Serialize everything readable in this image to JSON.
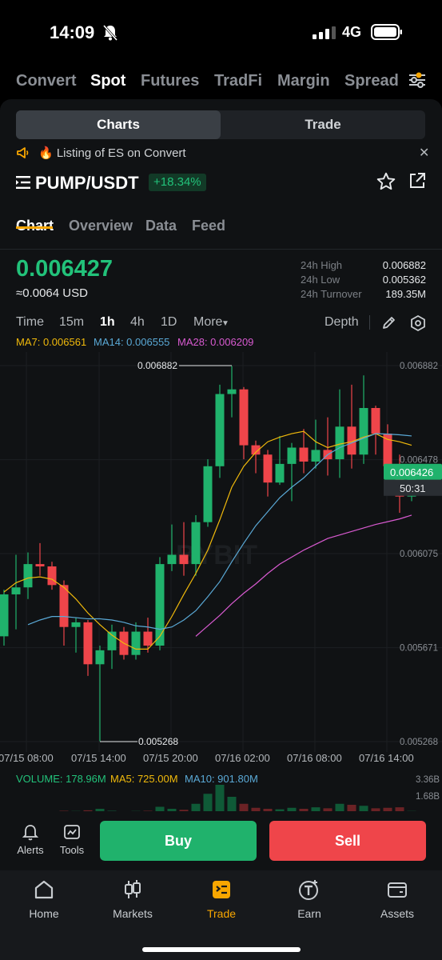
{
  "status_bar": {
    "time": "14:09",
    "network": "4G"
  },
  "top_nav": {
    "items": [
      "Convert",
      "Spot",
      "Futures",
      "TradFi",
      "Margin",
      "Spread"
    ],
    "active": "Spot"
  },
  "toggle": {
    "left": "Charts",
    "right": "Trade"
  },
  "announcement": {
    "text": "🔥 Listing of ES on Convert"
  },
  "pair": {
    "name": "PUMP/USDT",
    "change": "+18.34%"
  },
  "sub_tabs": [
    "Chart",
    "Overview",
    "Data",
    "Feed"
  ],
  "price": {
    "last": "0.006427",
    "usd": "≈0.0064 USD"
  },
  "stats": {
    "high_label": "24h High",
    "high": "0.006882",
    "low_label": "24h Low",
    "low": "0.005362",
    "turnover_label": "24h Turnover",
    "turnover": "189.35M"
  },
  "intervals": {
    "items": [
      "Time",
      "15m",
      "1h",
      "4h",
      "1D",
      "More"
    ],
    "active": "1h",
    "depth": "Depth"
  },
  "ma": {
    "ma7": "MA7: 0.006561",
    "ma14": "MA14: 0.006555",
    "ma28": "MA28: 0.006209"
  },
  "colors": {
    "up": "#20b26c",
    "down": "#ef454a",
    "ma7": "#f0b90b",
    "ma14": "#5aa9d6",
    "ma28": "#d85ad0",
    "accent": "#f7a600"
  },
  "chart_data": {
    "type": "candlestick",
    "y_ticks": [
      "0.006882",
      "0.006478",
      "0.006075",
      "0.005671",
      "0.005268"
    ],
    "x_ticks": [
      "07/15 08:00",
      "07/15 14:00",
      "07/15 20:00",
      "07/16 02:00",
      "07/16 08:00",
      "07/16 14:00"
    ],
    "ylim": [
      0.005268,
      0.006882
    ],
    "high_marker": "0.006882",
    "low_marker": "0.005268",
    "current_price": "0.006426",
    "countdown": "50:31",
    "candles": [
      [
        0.00572,
        0.0059,
        0.00568,
        0.00592
      ],
      [
        0.0059,
        0.00593,
        0.00575,
        0.00607
      ],
      [
        0.00593,
        0.00603,
        0.00588,
        0.00608
      ],
      [
        0.00603,
        0.00602,
        0.00598,
        0.00612
      ],
      [
        0.00602,
        0.00594,
        0.00592,
        0.00604
      ],
      [
        0.00594,
        0.00576,
        0.00568,
        0.00596
      ],
      [
        0.00576,
        0.00578,
        0.00565,
        0.0058
      ],
      [
        0.00578,
        0.0056,
        0.00555,
        0.00579
      ],
      [
        0.0056,
        0.00566,
        0.00527,
        0.00568
      ],
      [
        0.00566,
        0.00574,
        0.00558,
        0.00577
      ],
      [
        0.00574,
        0.00564,
        0.00562,
        0.00576
      ],
      [
        0.00564,
        0.00574,
        0.00562,
        0.00578
      ],
      [
        0.00574,
        0.00568,
        0.00565,
        0.0058
      ],
      [
        0.00568,
        0.00603,
        0.00566,
        0.00606
      ],
      [
        0.00603,
        0.00607,
        0.006,
        0.0062
      ],
      [
        0.00607,
        0.00603,
        0.00598,
        0.00621
      ],
      [
        0.00603,
        0.00621,
        0.00598,
        0.00624
      ],
      [
        0.00621,
        0.00645,
        0.00619,
        0.00648
      ],
      [
        0.00645,
        0.00676,
        0.0064,
        0.0068
      ],
      [
        0.00676,
        0.00678,
        0.00666,
        0.00688
      ],
      [
        0.00678,
        0.00654,
        0.00648,
        0.00679
      ],
      [
        0.00654,
        0.0065,
        0.00642,
        0.00656
      ],
      [
        0.0065,
        0.00638,
        0.00632,
        0.00652
      ],
      [
        0.00638,
        0.00646,
        0.00637,
        0.00658
      ],
      [
        0.00646,
        0.00653,
        0.0063,
        0.00655
      ],
      [
        0.00653,
        0.00647,
        0.00642,
        0.00661
      ],
      [
        0.00647,
        0.00652,
        0.00644,
        0.00665
      ],
      [
        0.00652,
        0.00648,
        0.00641,
        0.00666
      ],
      [
        0.00648,
        0.00662,
        0.0064,
        0.00678
      ],
      [
        0.00662,
        0.0065,
        0.00644,
        0.0068
      ],
      [
        0.0065,
        0.0067,
        0.00646,
        0.00684
      ],
      [
        0.0067,
        0.00659,
        0.0065,
        0.00671
      ],
      [
        0.00659,
        0.00645,
        0.0064,
        0.00663
      ],
      [
        0.00645,
        0.00632,
        0.00625,
        0.0065
      ],
      [
        0.00632,
        0.00643,
        0.0063,
        0.00645
      ]
    ],
    "ma7_values": [
      0.00591,
      0.00595,
      0.00597,
      0.005975,
      0.005965,
      0.00593,
      0.00588,
      0.00582,
      0.00577,
      0.005725,
      0.00569,
      0.005665,
      0.005665,
      0.00572,
      0.005805,
      0.0059,
      0.00599,
      0.00609,
      0.00622,
      0.00636,
      0.00645,
      0.00651,
      0.006555,
      0.006575,
      0.00659,
      0.0066,
      0.006555,
      0.00653,
      0.006545,
      0.006555,
      0.006575,
      0.00659,
      0.006565,
      0.006555,
      0.00654
    ],
    "ma14_values": [
      null,
      null,
      0.00577,
      0.00579,
      0.005805,
      0.005805,
      0.0058,
      0.005795,
      0.005795,
      0.00579,
      0.00578,
      0.005765,
      0.00576,
      0.00575,
      0.00576,
      0.00579,
      0.00583,
      0.00589,
      0.005955,
      0.00604,
      0.00612,
      0.006195,
      0.006255,
      0.006315,
      0.00636,
      0.0064,
      0.00645,
      0.0065,
      0.00653,
      0.00655,
      0.00657,
      0.00659,
      0.006588,
      0.006585,
      0.00658
    ],
    "ma28_values": [
      null,
      null,
      null,
      null,
      null,
      null,
      null,
      null,
      null,
      null,
      null,
      null,
      null,
      null,
      null,
      null,
      0.00572,
      0.005765,
      0.00581,
      0.00586,
      0.005905,
      0.005945,
      0.00599,
      0.00603,
      0.00606,
      0.00609,
      0.006115,
      0.00614,
      0.006155,
      0.00617,
      0.006185,
      0.0062,
      0.006212,
      0.006224,
      0.00624
    ],
    "volume": {
      "label": "VOLUME: 178.96M",
      "ma5": "MA5: 725.00M",
      "ma10": "MA10: 901.80M",
      "y_ticks": [
        "3.36B",
        "1.68B"
      ],
      "values_b": [
        0.1,
        0.15,
        0.12,
        0.1,
        0.14,
        0.2,
        0.18,
        0.25,
        0.4,
        0.2,
        0.15,
        0.18,
        0.2,
        0.6,
        0.4,
        0.3,
        0.9,
        1.9,
        2.8,
        1.6,
        0.9,
        0.5,
        0.4,
        0.35,
        0.5,
        0.4,
        0.55,
        0.45,
        0.9,
        0.8,
        0.7,
        0.45,
        0.5,
        0.55,
        0.18
      ]
    }
  },
  "actions": {
    "alerts": "Alerts",
    "tools": "Tools",
    "buy": "Buy",
    "sell": "Sell"
  },
  "tabbar": {
    "items": [
      "Home",
      "Markets",
      "Trade",
      "Earn",
      "Assets"
    ],
    "active": "Trade"
  }
}
